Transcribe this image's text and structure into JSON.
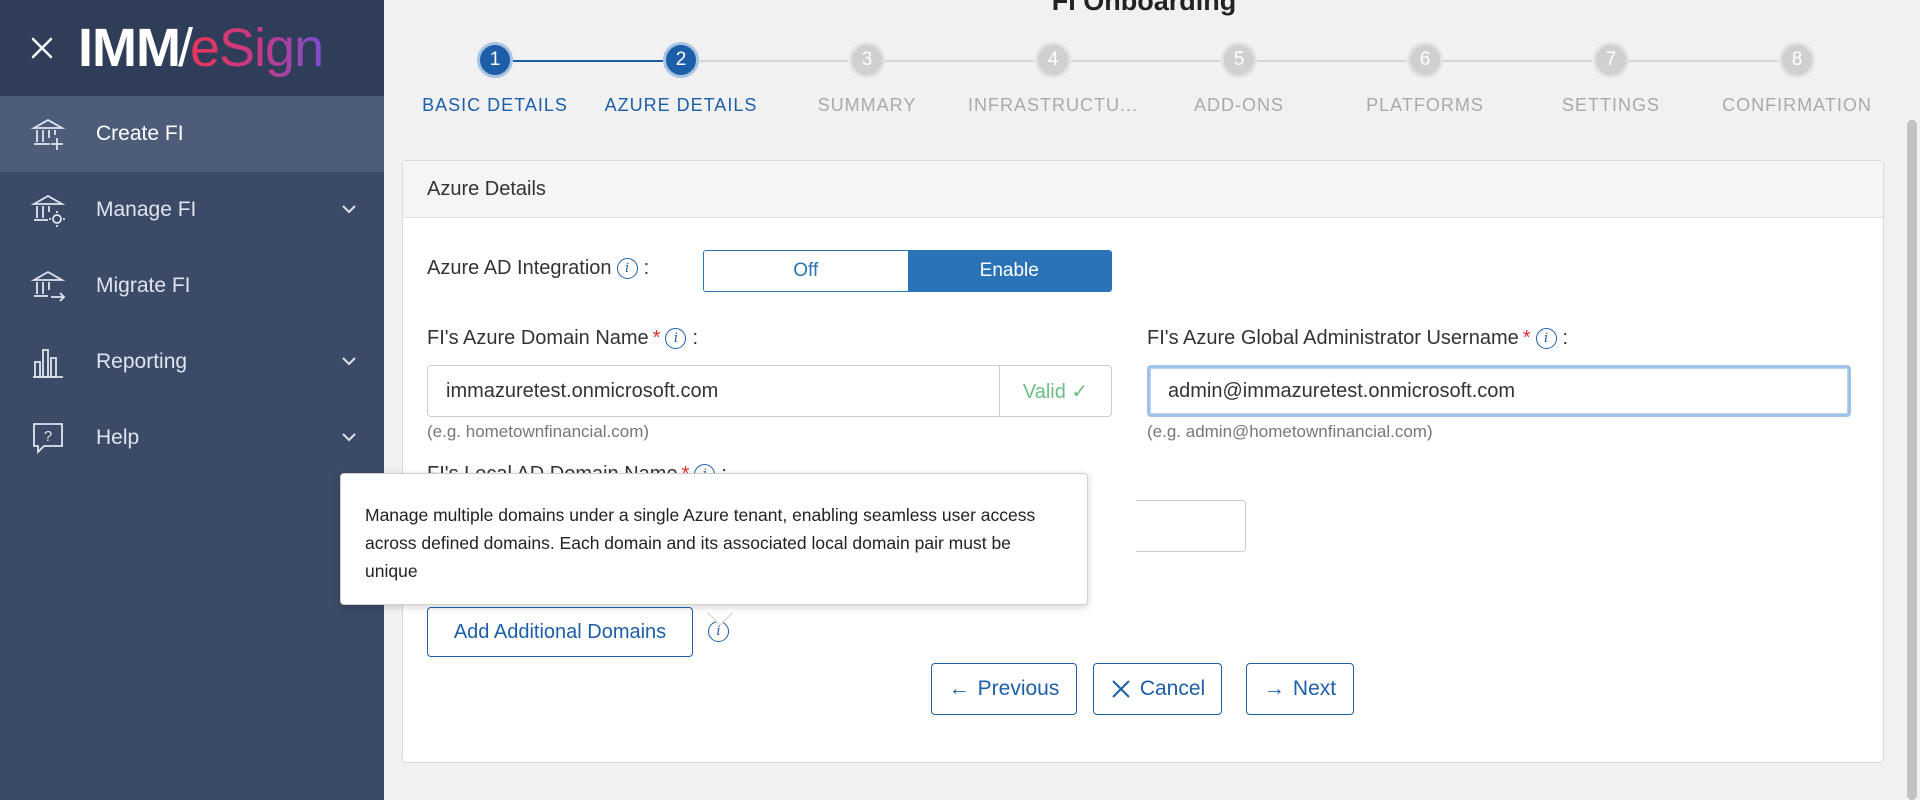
{
  "app": {
    "logo_text_imm": "IMM",
    "logo_text_esign": "eSign",
    "page_title": "FI Onboarding"
  },
  "sidebar": {
    "items": [
      {
        "label": "Create FI",
        "icon": "bank-add-icon",
        "active": true,
        "has_chevron": false
      },
      {
        "label": "Manage FI",
        "icon": "bank-gear-icon",
        "active": false,
        "has_chevron": true
      },
      {
        "label": "Migrate FI",
        "icon": "bank-arrow-icon",
        "active": false,
        "has_chevron": false
      },
      {
        "label": "Reporting",
        "icon": "bar-chart-icon",
        "active": false,
        "has_chevron": true
      },
      {
        "label": "Help",
        "icon": "help-bubble-icon",
        "active": false,
        "has_chevron": true
      }
    ]
  },
  "stepper": {
    "steps": [
      {
        "number": "1",
        "label": "BASIC DETAILS",
        "state": "done"
      },
      {
        "number": "2",
        "label": "AZURE DETAILS",
        "state": "current"
      },
      {
        "number": "3",
        "label": "SUMMARY",
        "state": "upcoming"
      },
      {
        "number": "4",
        "label": "INFRASTRUCTU...",
        "state": "upcoming"
      },
      {
        "number": "5",
        "label": "ADD-ONS",
        "state": "upcoming"
      },
      {
        "number": "6",
        "label": "PLATFORMS",
        "state": "upcoming"
      },
      {
        "number": "7",
        "label": "SETTINGS",
        "state": "upcoming"
      },
      {
        "number": "8",
        "label": "CONFIRMATION",
        "state": "upcoming"
      }
    ]
  },
  "card": {
    "title": "Azure Details",
    "ad_integration": {
      "label": "Azure AD Integration",
      "off_label": "Off",
      "on_label": "Enable",
      "selected": "Enable"
    },
    "domain_name": {
      "label": "FI's Azure Domain Name",
      "value": "immazuretest.onmicrosoft.com",
      "status": "Valid ✓",
      "hint": "(e.g. hometownfinancial.com)"
    },
    "admin_username": {
      "label": "FI's Azure Global Administrator Username",
      "value": "admin@immazuretest.onmicrosoft.com",
      "hint": "(e.g. admin@hometownfinancial.com)"
    },
    "local_domain": {
      "label": "FI's Local AD Domain Name"
    },
    "add_domains_button": "Add Additional Domains",
    "tooltip": "Manage multiple domains under a single Azure tenant, enabling seamless user access across defined domains. Each domain and its associated local domain pair must be unique",
    "buttons": {
      "previous": "Previous",
      "cancel": "Cancel",
      "next": "Next"
    }
  },
  "colors": {
    "sidebar_bg": "#3b4a66",
    "accent": "#1c5fa8",
    "valid": "#6dbf85",
    "required": "#d9302c"
  }
}
